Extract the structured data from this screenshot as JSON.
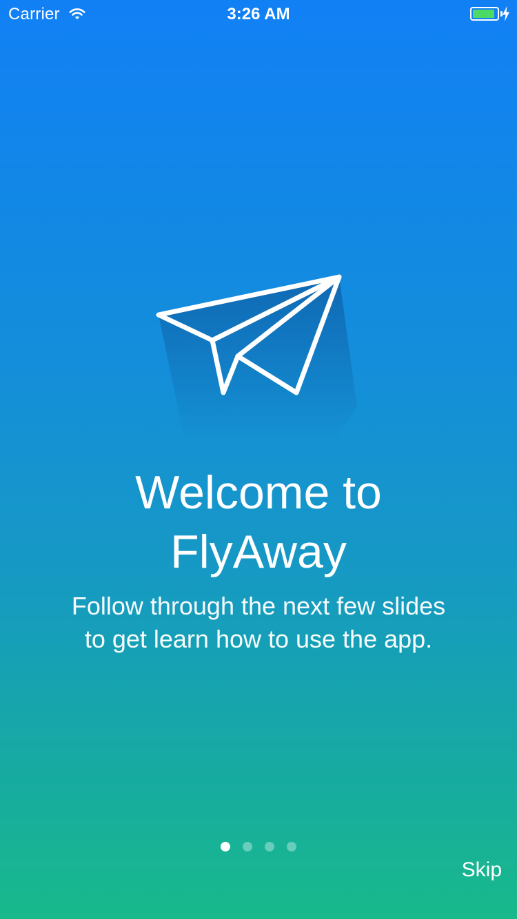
{
  "status_bar": {
    "carrier": "Carrier",
    "time": "3:26 AM",
    "battery_level": 0.9,
    "battery_color": "#4cd964",
    "icons": [
      "wifi-icon",
      "battery-icon",
      "charging-bolt-icon"
    ]
  },
  "onboarding": {
    "title_line1": "Welcome to",
    "title_line2": "FlyAway",
    "subtitle_line1": "Follow through the next few slides",
    "subtitle_line2": "to get learn how to use the app.",
    "illustration_icon": "paper-plane-icon",
    "page_count": 4,
    "current_page": 1,
    "skip_label": "Skip"
  },
  "colors": {
    "gradient_top": "#1180f5",
    "gradient_bottom": "#18b98b",
    "text": "#ffffff"
  }
}
